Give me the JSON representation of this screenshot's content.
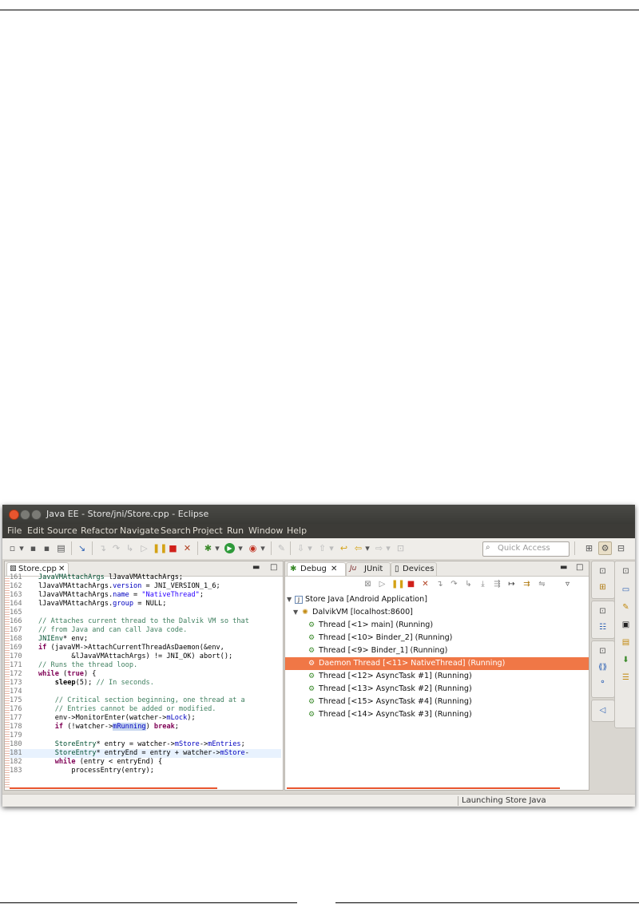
{
  "window": {
    "title": "Java EE - Store/jni/Store.cpp - Eclipse"
  },
  "menu": [
    "File",
    "Edit",
    "Source",
    "Refactor",
    "Navigate",
    "Search",
    "Project",
    "Run",
    "Window",
    "Help"
  ],
  "toolbar": {
    "quick_access_placeholder": "Quick Access"
  },
  "editor": {
    "tab_label": "Store.cpp",
    "lines": [
      {
        "n": "161",
        "code": "JavaVMAttachArgs lJavaVMAttachArgs;"
      },
      {
        "n": "162",
        "code": "lJavaVMAttachArgs.version = JNI_VERSION_1_6;"
      },
      {
        "n": "163",
        "code": "lJavaVMAttachArgs.name = \"NativeThread\";"
      },
      {
        "n": "164",
        "code": "lJavaVMAttachArgs.group = NULL;"
      },
      {
        "n": "165",
        "code": ""
      },
      {
        "n": "166",
        "code": "// Attaches current thread to the Dalvik VM so that"
      },
      {
        "n": "167",
        "code": "// from Java and can call Java code."
      },
      {
        "n": "168",
        "code": "JNIEnv* env;"
      },
      {
        "n": "169",
        "code": "if (javaVM->AttachCurrentThreadAsDaemon(&env,"
      },
      {
        "n": "170",
        "code": "        &lJavaVMAttachArgs) != JNI_OK) abort();"
      },
      {
        "n": "171",
        "code": "// Runs the thread loop."
      },
      {
        "n": "172",
        "code": "while (true) {"
      },
      {
        "n": "173",
        "code": "    sleep(5); // In seconds."
      },
      {
        "n": "174",
        "code": ""
      },
      {
        "n": "175",
        "code": "    // Critical section beginning, one thread at a"
      },
      {
        "n": "176",
        "code": "    // Entries cannot be added or modified."
      },
      {
        "n": "177",
        "code": "    env->MonitorEnter(watcher->mLock);"
      },
      {
        "n": "178",
        "code": "    if (!watcher->mRunning) break;"
      },
      {
        "n": "179",
        "code": ""
      },
      {
        "n": "180",
        "code": "    StoreEntry* entry = watcher->mStore->mEntries;"
      },
      {
        "n": "181",
        "code": "    StoreEntry* entryEnd = entry + watcher->mStore-"
      },
      {
        "n": "182",
        "code": "    while (entry < entryEnd) {"
      },
      {
        "n": "183",
        "code": "        processEntry(entry);"
      }
    ]
  },
  "debug": {
    "tabs": [
      "Debug",
      "JUnit",
      "Devices"
    ],
    "tree": [
      {
        "level": 0,
        "twist": "▼",
        "label": "Store Java [Android Application]",
        "selected": false
      },
      {
        "level": 1,
        "twist": "▼",
        "label": "DalvikVM [localhost:8600]",
        "selected": false
      },
      {
        "level": 2,
        "twist": "",
        "label": "Thread [<1> main] (Running)",
        "selected": false
      },
      {
        "level": 2,
        "twist": "",
        "label": "Thread [<10> Binder_2] (Running)",
        "selected": false
      },
      {
        "level": 2,
        "twist": "",
        "label": "Thread [<9> Binder_1] (Running)",
        "selected": false
      },
      {
        "level": 2,
        "twist": "",
        "label": "Daemon Thread [<11> NativeThread] (Running)",
        "selected": true
      },
      {
        "level": 2,
        "twist": "",
        "label": "Thread [<12> AsyncTask #1] (Running)",
        "selected": false
      },
      {
        "level": 2,
        "twist": "",
        "label": "Thread [<13> AsyncTask #2] (Running)",
        "selected": false
      },
      {
        "level": 2,
        "twist": "",
        "label": "Thread [<15> AsyncTask #4] (Running)",
        "selected": false
      },
      {
        "level": 2,
        "twist": "",
        "label": "Thread [<14> AsyncTask #3] (Running)",
        "selected": false
      }
    ]
  },
  "status": {
    "text": "Launching Store Java"
  },
  "colors": {
    "selection": "#f07746",
    "accent": "#e8552e"
  }
}
